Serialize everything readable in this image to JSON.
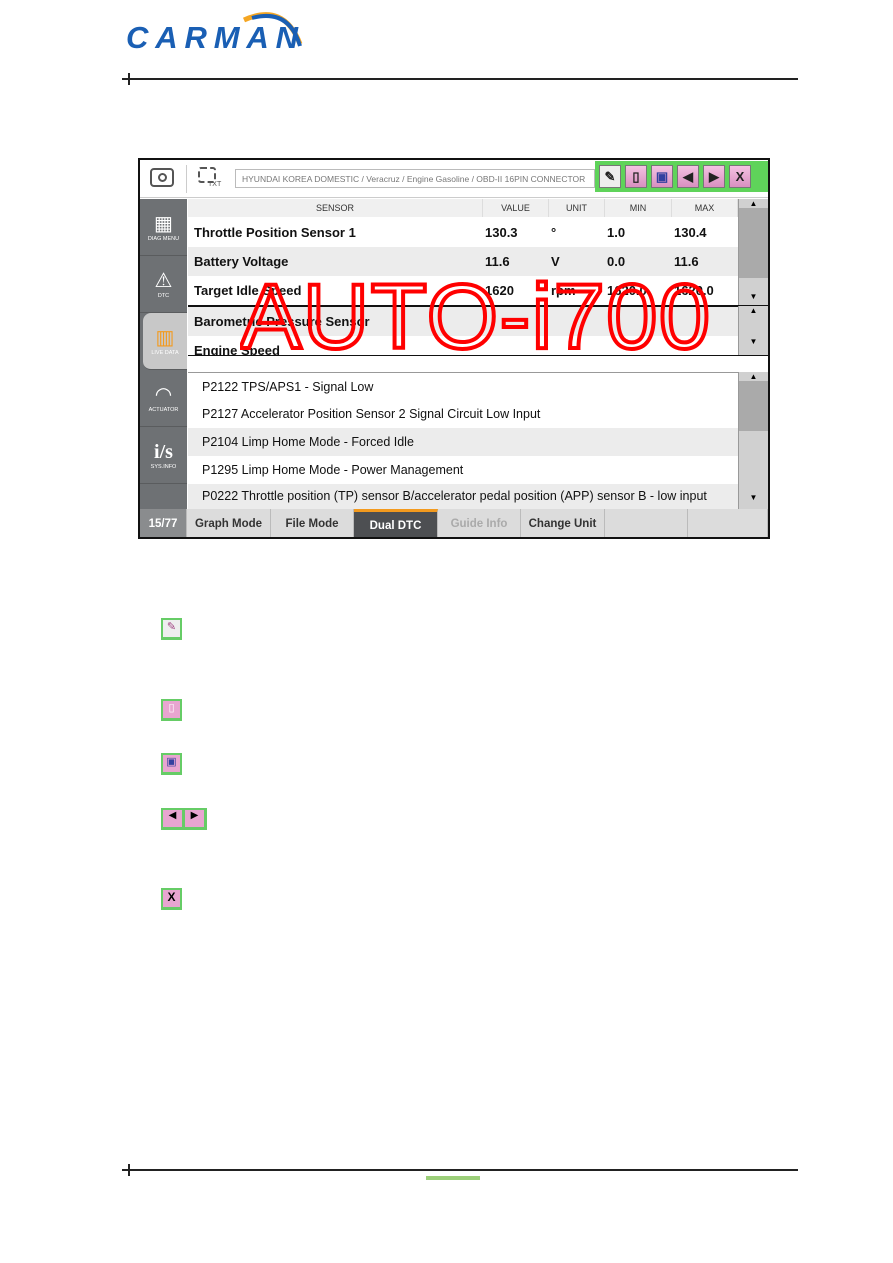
{
  "logo": {
    "text": "CARMAN",
    "colors": {
      "blue": "#1a5fb4",
      "orange": "#f5a623"
    }
  },
  "screen": {
    "path": "HYUNDAI KOREA DOMESTIC / Veracruz / Engine Gasoline / OBD-II 16PIN CONNECTOR",
    "txt_label": "TXT",
    "toolbar": {
      "edit": "✎",
      "file": "▯",
      "save": "💾",
      "prev": "◀",
      "next": "▶",
      "close": "X"
    },
    "sidebar": [
      {
        "label": "DIAG MENU",
        "icon": "grid-icon"
      },
      {
        "label": "DTC",
        "icon": "warning-icon"
      },
      {
        "label": "LIVE DATA",
        "icon": "chart-icon"
      },
      {
        "label": "ACTUATOR",
        "icon": "gauge-icon"
      },
      {
        "label": "SYS.INFO",
        "icon": "info-icon"
      }
    ],
    "columns": [
      "SENSOR",
      "VALUE",
      "UNIT",
      "MIN",
      "MAX"
    ],
    "rows": [
      {
        "sensor": "Throttle Position Sensor 1",
        "value": "130.3",
        "unit": "°",
        "min": "1.0",
        "max": "130.4"
      },
      {
        "sensor": "Battery Voltage",
        "value": "11.6",
        "unit": "V",
        "min": "0.0",
        "max": "11.6"
      },
      {
        "sensor": "Target Idle Speed",
        "value": "1620",
        "unit": "rpm",
        "min": "1620.0",
        "max": "1620.0"
      }
    ],
    "rows2": [
      {
        "sensor": "Barometric Pressure Sensor"
      },
      {
        "sensor": "Engine Speed"
      }
    ],
    "dtcs": [
      "P2122 TPS/APS1 - Signal Low",
      "P2127 Accelerator Position Sensor 2 Signal Circuit Low Input",
      "P2104 Limp Home Mode - Forced Idle",
      "P1295 Limp Home Mode - Power Management",
      "P0222 Throttle position (TP) sensor B/accelerator pedal position (APP) sensor B - low input"
    ],
    "page": "15/77",
    "tabs": [
      "Graph Mode",
      "File Mode",
      "Dual DTC",
      "Guide Info",
      "Change Unit",
      "",
      ""
    ],
    "active_tab": "Dual DTC",
    "handwriting": "AUTO-i700"
  },
  "legend_icons": [
    {
      "icon": "pencil-icon",
      "glyph": "✎"
    },
    {
      "icon": "file-icon",
      "glyph": "▯"
    },
    {
      "icon": "save-icon",
      "glyph": "▣"
    },
    {
      "icon": "prev-icon",
      "glyph": "◀"
    },
    {
      "icon": "next-icon",
      "glyph": "▶"
    },
    {
      "icon": "close-icon",
      "glyph": "X"
    }
  ]
}
